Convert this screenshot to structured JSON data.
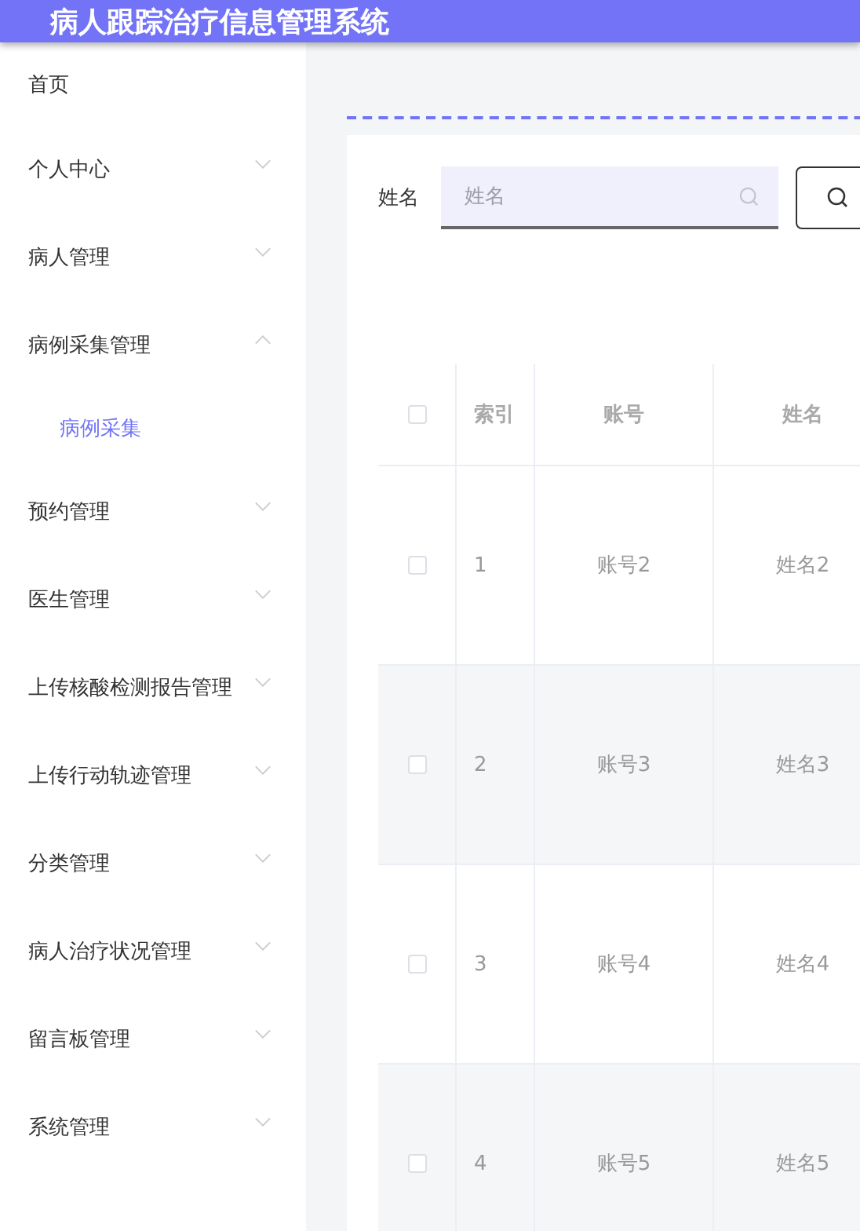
{
  "header": {
    "title": "病人跟踪治疗信息管理系统"
  },
  "sidebar": {
    "items": [
      {
        "label": "首页",
        "kind": "link",
        "selected": false
      },
      {
        "label": "个人中心",
        "kind": "group",
        "expanded": false,
        "selected": false
      },
      {
        "label": "病人管理",
        "kind": "group",
        "expanded": false,
        "selected": false
      },
      {
        "label": "病例采集管理",
        "kind": "group",
        "expanded": true,
        "selected": false,
        "children": [
          {
            "label": "病例采集",
            "selected": true
          }
        ]
      },
      {
        "label": "预约管理",
        "kind": "group",
        "expanded": false,
        "selected": false
      },
      {
        "label": "医生管理",
        "kind": "group",
        "expanded": false,
        "selected": false
      },
      {
        "label": "上传核酸检测报告管理",
        "kind": "group",
        "expanded": false,
        "selected": false
      },
      {
        "label": "上传行动轨迹管理",
        "kind": "group",
        "expanded": false,
        "selected": false
      },
      {
        "label": "分类管理",
        "kind": "group",
        "expanded": false,
        "selected": false
      },
      {
        "label": "病人治疗状况管理",
        "kind": "group",
        "expanded": false,
        "selected": false
      },
      {
        "label": "留言板管理",
        "kind": "group",
        "expanded": false,
        "selected": false
      },
      {
        "label": "系统管理",
        "kind": "group",
        "expanded": false,
        "selected": false
      }
    ]
  },
  "search": {
    "label": "姓名",
    "placeholder": "姓名"
  },
  "table": {
    "header_checked": false,
    "columns": [
      "索引",
      "账号",
      "姓名"
    ],
    "rows": [
      {
        "checked": false,
        "cells": [
          "1",
          "账号2",
          "姓名2"
        ]
      },
      {
        "checked": false,
        "cells": [
          "2",
          "账号3",
          "姓名3"
        ]
      },
      {
        "checked": false,
        "cells": [
          "3",
          "账号4",
          "姓名4"
        ]
      },
      {
        "checked": false,
        "cells": [
          "4",
          "账号5",
          "姓名5"
        ]
      }
    ]
  }
}
